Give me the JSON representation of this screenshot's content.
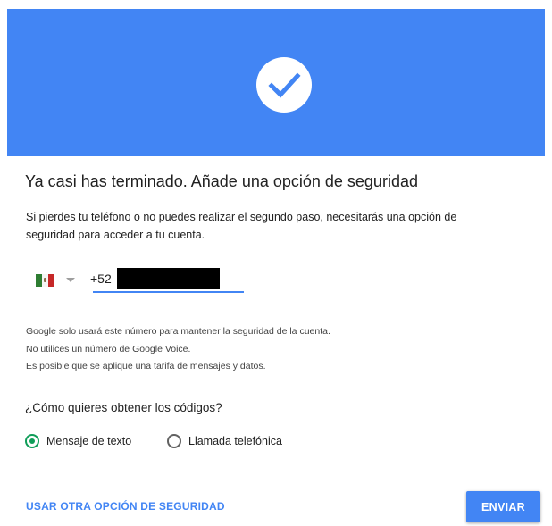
{
  "header": {
    "icon": "check-circle-icon",
    "background_color": "#4285f4"
  },
  "title": "Ya casi has terminado. Añade una opción de seguridad",
  "description": "Si pierdes tu teléfono o no puedes realizar el segundo paso, necesitarás una opción de seguridad para acceder a tu cuenta.",
  "phone": {
    "country_flag_icon": "mexico-flag-icon",
    "country_code": "+52",
    "number_value": "",
    "underline_color": "#4285f4"
  },
  "notes": [
    "Google solo usará este número para mantener la seguridad de la cuenta.",
    "No utilices un número de Google Voice.",
    "Es posible que se aplique una tarifa de mensajes y datos."
  ],
  "question": "¿Cómo quieres obtener los códigos?",
  "methods": [
    {
      "label": "Mensaje de texto",
      "selected": true
    },
    {
      "label": "Llamada telefónica",
      "selected": false
    }
  ],
  "actions": {
    "alternative_label": "USAR OTRA OPCIÓN DE SEGURIDAD",
    "submit_label": "ENVIAR"
  },
  "colors": {
    "accent": "#4285f4",
    "radio_selected": "#0f9d58"
  }
}
